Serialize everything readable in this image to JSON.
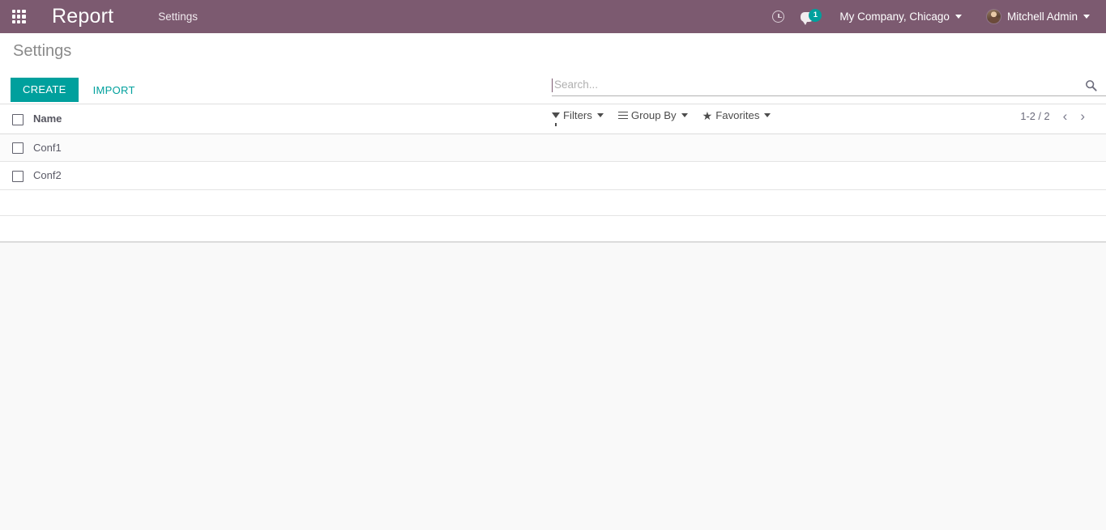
{
  "navbar": {
    "apps_icon": "apps-grid-icon",
    "brand": "Report",
    "menu_items": [
      {
        "label": "Settings"
      }
    ],
    "activity_icon": "clock-icon",
    "messages_icon": "speech-bubble-icon",
    "messages_badge": "1",
    "company": "My Company, Chicago",
    "user_name": "Mitchell Admin",
    "avatar_icon": "user-avatar",
    "bg_color": "#7c5a70"
  },
  "control_panel": {
    "breadcrumb": "Settings",
    "create_label": "CREATE",
    "import_label": "IMPORT",
    "accent_color": "#00a09d",
    "search": {
      "value": "",
      "placeholder": "Search...",
      "icon": "search-icon"
    },
    "filters": [
      {
        "label": "Filters",
        "icon": "funnel-icon"
      },
      {
        "label": "Group By",
        "icon": "list-lines-icon"
      },
      {
        "label": "Favorites",
        "icon": "star-icon"
      }
    ],
    "pager": {
      "count": "1-2 / 2",
      "prev_icon": "chevron-left-icon",
      "next_icon": "chevron-right-icon"
    }
  },
  "list": {
    "columns": [
      "Name"
    ],
    "rows": [
      {
        "name": "Conf1"
      },
      {
        "name": "Conf2"
      }
    ]
  }
}
